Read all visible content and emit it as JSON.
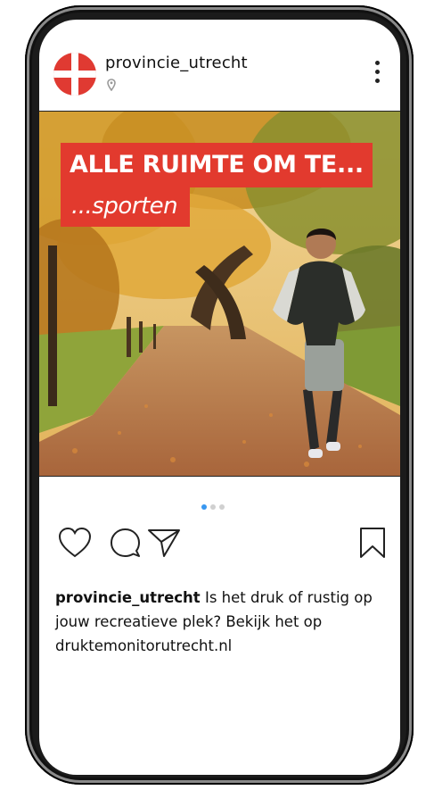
{
  "post": {
    "username": "provincie_utrecht",
    "banner_line1": "ALLE RUIMTE OM TE...",
    "banner_line2": "...sporten",
    "caption_user": "provincie_utrecht",
    "caption_text": " Is het druk of rustig op jouw recreatieve plek? Bekijk het op druktemonitorutrecht.nl",
    "carousel_count": 3,
    "carousel_active": 1
  },
  "colors": {
    "brand_red": "#e23a2e",
    "active_dot": "#3897f0"
  },
  "icons": [
    "location-pin-icon",
    "more-options-icon",
    "heart-icon",
    "comment-icon",
    "share-icon",
    "bookmark-icon"
  ]
}
